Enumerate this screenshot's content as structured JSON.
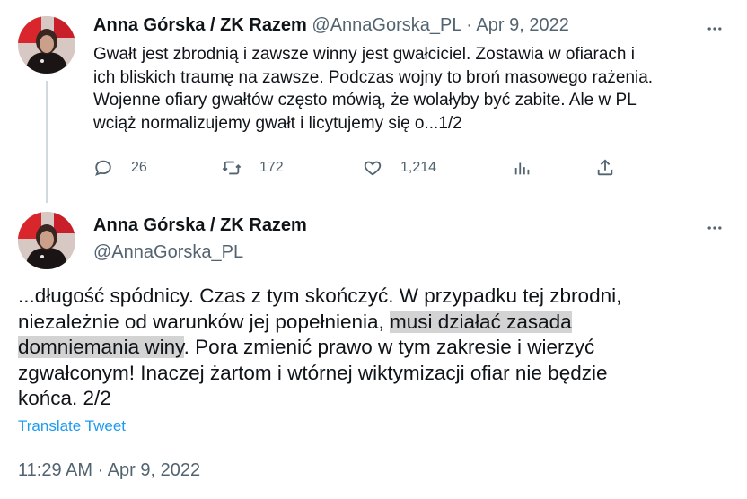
{
  "tweet1": {
    "author_name": "Anna Górska / ZK Razem",
    "author_handle": "@AnnaGorska_PL",
    "separator": "·",
    "date": "Apr 9, 2022",
    "text_lines": [
      "Gwałt jest zbrodnią i zawsze winny jest gwałciciel. Zostawia w ofiarach i",
      "ich bliskich traumę na zawsze. Podczas wojny to broń masowego rażenia.",
      "Wojenne ofiary gwałtów często mówią, że wolałyby być zabite. Ale w PL",
      "wciąż normalizujemy gwałt i licytujemy się o...1/2"
    ],
    "replies": "26",
    "retweets": "172",
    "likes": "1,214"
  },
  "tweet2": {
    "author_name": "Anna Górska / ZK Razem",
    "author_handle": "@AnnaGorska_PL",
    "text_part1": "...długość spódnicy. Czas z tym skończyć. W przypadku tej zbrodni,",
    "text_part2": "niezależnie od warunków jej popełnienia, ",
    "text_highlight_1": "musi działać zasada",
    "text_highlight_2": "domniemania winy",
    "text_part3": ". Pora zmienić prawo w tym zakresie i wierzyć",
    "text_part4": "zgwałconym! Inaczej żartom i wtórnej wiktymizacji ofiar nie będzie",
    "text_part5": "końca. 2/2",
    "translate_label": "Translate Tweet",
    "timestamp": "11:29 AM · Apr 9, 2022"
  },
  "icons": {
    "reply": "reply-icon",
    "retweet": "retweet-icon",
    "like": "like-icon",
    "views": "analytics-icon",
    "share": "share-icon",
    "more": "more-icon"
  },
  "colors": {
    "link": "#1d9bf0",
    "secondary_text": "#536471",
    "highlight": "#d3d3d3"
  }
}
